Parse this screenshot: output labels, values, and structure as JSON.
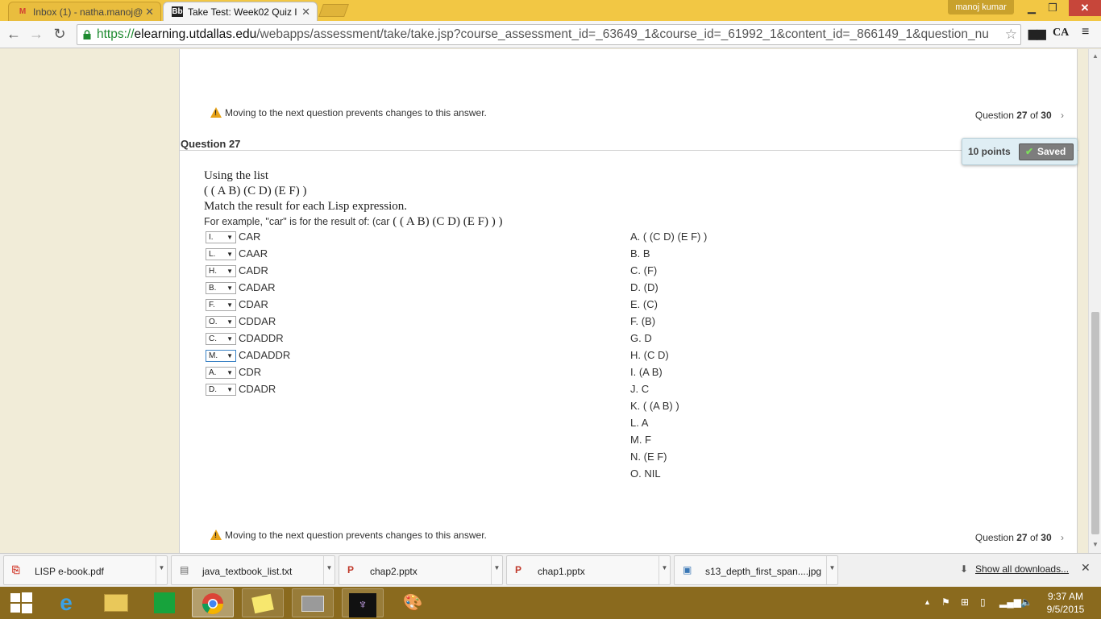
{
  "browser": {
    "tabs": [
      {
        "title": "Inbox (1) - natha.manoj@",
        "favicon": "gmail-icon",
        "active": false
      },
      {
        "title": "Take Test: Week02 Quiz I",
        "favicon": "blackboard-icon",
        "active": true
      }
    ],
    "profile_name": "manoj kumar",
    "url": {
      "scheme": "https://",
      "host": "elearning.utdallas.edu",
      "path": "/webapps/assessment/take/take.jsp?course_assessment_id=_63649_1&course_id=_61992_1&content_id=_866149_1&question_nu"
    },
    "extension_label": "CA"
  },
  "test": {
    "warning_text": "Moving to the next question prevents changes to this answer.",
    "question_nav": {
      "prefix": "Question",
      "current": "27",
      "of": "of",
      "total": "30"
    },
    "question_title": "Question 27",
    "points": "10 points",
    "saved_label": "Saved",
    "stem": {
      "line1": "Using the list",
      "line2": "( ( A B) (C D) (E F) )",
      "line3": "Match the result for each Lisp expression.",
      "line4_prefix": "For example, \"car\" is for the result of: (car",
      "line4_serif": " ( ( A B) (C D) (E F) ) )"
    },
    "prompts": [
      {
        "selected": "I.",
        "text": "CAR"
      },
      {
        "selected": "L.",
        "text": "CAAR"
      },
      {
        "selected": "H.",
        "text": "CADR"
      },
      {
        "selected": "B.",
        "text": "CADAR"
      },
      {
        "selected": "F.",
        "text": "CDAR"
      },
      {
        "selected": "O.",
        "text": "CDDAR"
      },
      {
        "selected": "C.",
        "text": "CDADDR"
      },
      {
        "selected": "M.",
        "text": "CADADDR"
      },
      {
        "selected": "A.",
        "text": "CDR"
      },
      {
        "selected": "D.",
        "text": "CDADR"
      }
    ],
    "answers": [
      "A. ( (C D) (E F) )",
      "B. B",
      "C. (F)",
      "D. (D)",
      "E. (C)",
      "F. (B)",
      "G. D",
      "H. (C D)",
      "I.  (A B)",
      "J.  C",
      "K. ( (A B) )",
      "L.  A",
      "M. F",
      "N. (E F)",
      "O. NIL"
    ]
  },
  "downloads": {
    "items": [
      {
        "name": "LISP e-book.pdf",
        "icon": "pdf-icon"
      },
      {
        "name": "java_textbook_list.txt",
        "icon": "text-file-icon"
      },
      {
        "name": "chap2.pptx",
        "icon": "pptx-icon"
      },
      {
        "name": "chap1.pptx",
        "icon": "pptx-icon"
      },
      {
        "name": "s13_depth_first_span....jpg",
        "icon": "image-file-icon"
      }
    ],
    "show_all": "Show all downloads..."
  },
  "taskbar": {
    "apps": [
      "start-icon",
      "internet-explorer-icon",
      "file-explorer-icon",
      "store-icon",
      "chrome-icon",
      "sticky-notes-icon",
      "photos-app-icon",
      "menorah-app-icon",
      "paint-icon"
    ],
    "time": "9:37 AM",
    "date": "9/5/2015"
  },
  "colors": {
    "chrome_frame": "#f2c744",
    "taskbar": "#8a6a1e",
    "page_bg": "#f1ecd8",
    "url_scheme": "#1d8a2f"
  }
}
